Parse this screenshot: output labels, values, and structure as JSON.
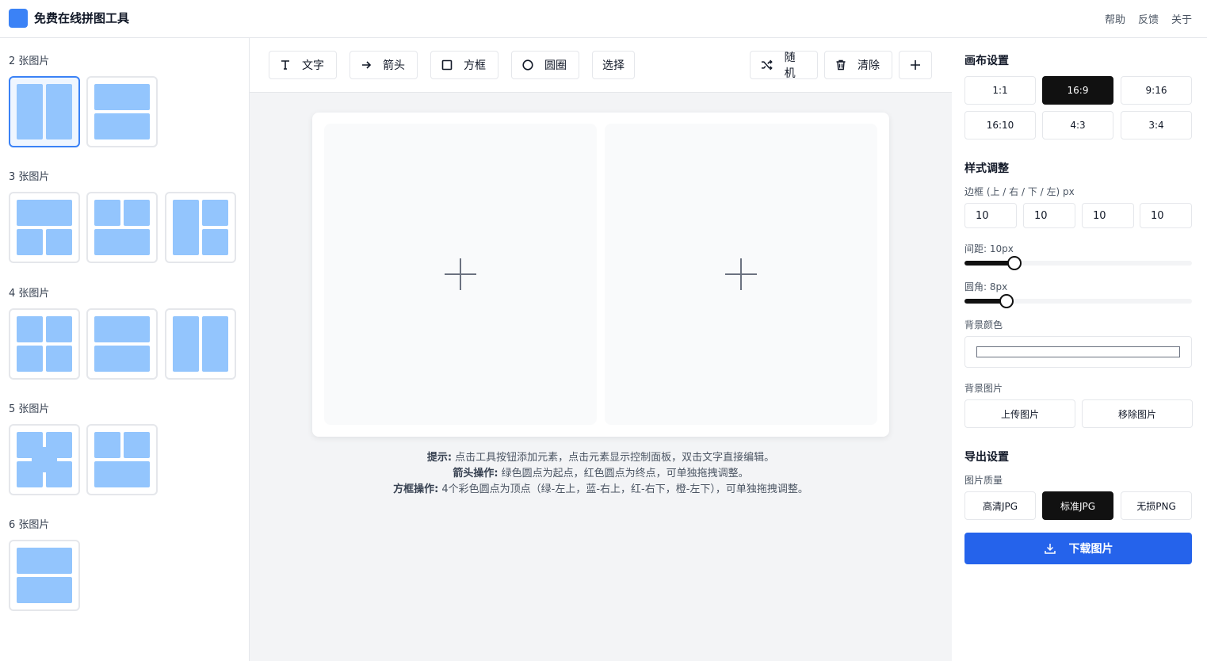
{
  "header": {
    "title": "免费在线拼图工具",
    "nav": [
      "帮助",
      "反馈",
      "关于"
    ],
    "logo_color": "#3b82f6"
  },
  "sidebar": {
    "groups": [
      {
        "label": "2 张图片",
        "templates": [
          "two-vertical",
          "two-horizontal"
        ],
        "selected": 0
      },
      {
        "label": "3 张图片",
        "templates": [
          "top-wide-bottom-two",
          "top-two-bottom-wide",
          "left-tall-right-two"
        ]
      },
      {
        "label": "4 张图片",
        "templates": [
          "grid-2x2",
          "two-rows",
          "two-columns"
        ]
      },
      {
        "label": "5 张图片",
        "templates": [
          "grid-center",
          "top-two-bottom-wide"
        ]
      },
      {
        "label": "6 张图片",
        "templates": [
          "two-rows"
        ]
      }
    ]
  },
  "toolbar": {
    "text": "文字",
    "arrow": "箭头",
    "box": "方框",
    "circle": "圆圈",
    "select": "选择",
    "random": "随机",
    "clear": "清除"
  },
  "hints": {
    "h1_label": "提示:",
    "h1_text": " 点击工具按钮添加元素，点击元素显示控制面板，双击文字直接编辑。",
    "h2_label": "箭头操作:",
    "h2_text": " 绿色圆点为起点，红色圆点为终点，可单独拖拽调整。",
    "h3_label": "方框操作:",
    "h3_text": " 4个彩色圆点为顶点（绿-左上，蓝-右上，红-右下，橙-左下），可单独拖拽调整。"
  },
  "settings": {
    "canvas_title": "画布设置",
    "ratios": [
      "1:1",
      "16:9",
      "9:16",
      "16:10",
      "4:3",
      "3:4"
    ],
    "selected_ratio": "16:9",
    "style_title": "样式调整",
    "border_label": "边框 (上 / 右 / 下 / 左) px",
    "border_values": [
      "10",
      "10",
      "10",
      "10"
    ],
    "spacing_label": "间距: 10px",
    "spacing_fraction": 0.22,
    "radius_label": "圆角: 8px",
    "radius_fraction": 0.185,
    "bg_color_label": "背景颜色",
    "bg_color": "#ffffff",
    "bg_image_label": "背景图片",
    "upload_label": "上传图片",
    "remove_label": "移除图片",
    "export_title": "导出设置",
    "quality_label": "图片质量",
    "qualities": [
      "高清JPG",
      "标准JPG",
      "无损PNG"
    ],
    "selected_quality": "标准JPG",
    "download_label": "下载图片",
    "accent_color": "#2563eb"
  }
}
